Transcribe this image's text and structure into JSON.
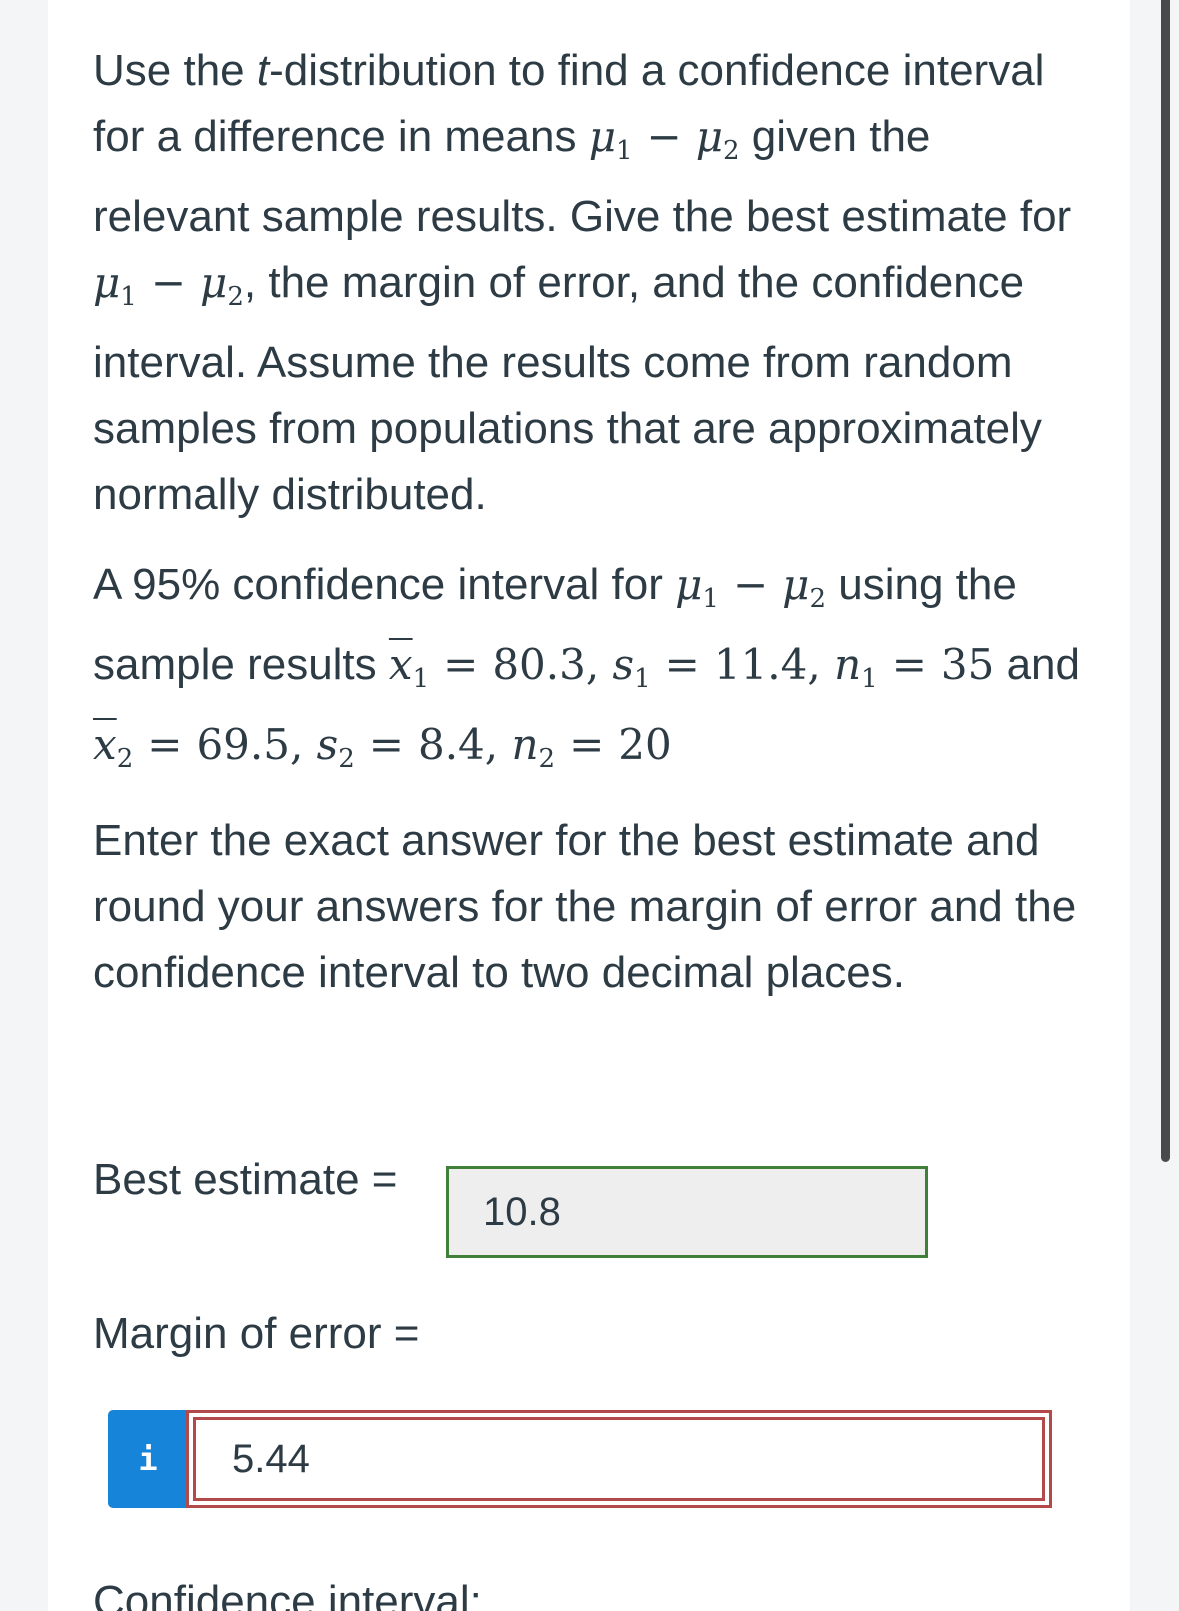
{
  "question": {
    "intro_text_1": "Use the ",
    "intro_t": "t",
    "intro_text_2": "-distribution to find a confidence interval for a difference in means ",
    "intro_text_3": " given the relevant sample results. Give the best estimate for ",
    "intro_text_4": ", the margin of error, and the confidence interval. Assume the results come from random samples from populations that are approximately normally distributed.",
    "data_text_1": "A 95% confidence interval for ",
    "data_text_2": " using the sample results ",
    "data_text_3": " and ",
    "x1_value": "80.3",
    "s1_value": "11.4",
    "n1_value": "35",
    "x2_value": "69.5",
    "s2_value": "8.4",
    "n2_value": "20",
    "instructions": "Enter the exact answer for the best estimate and round your answers for the margin of error and the confidence interval to two decimal places."
  },
  "symbols": {
    "mu": "μ",
    "x": "x",
    "s": "s",
    "n": "n",
    "sub1": "1",
    "sub2": "2",
    "minus": "−",
    "equals": "="
  },
  "answers": {
    "best_estimate_label": "Best estimate =",
    "best_estimate_value": "10.8",
    "margin_label": "Margin of error =",
    "info_icon": "i",
    "margin_value": "5.44",
    "ci_label": "Confidence interval:"
  },
  "colors": {
    "correct_border": "#3f7f3a",
    "incorrect_border": "#b24a4a",
    "info_button": "#1684d9"
  }
}
